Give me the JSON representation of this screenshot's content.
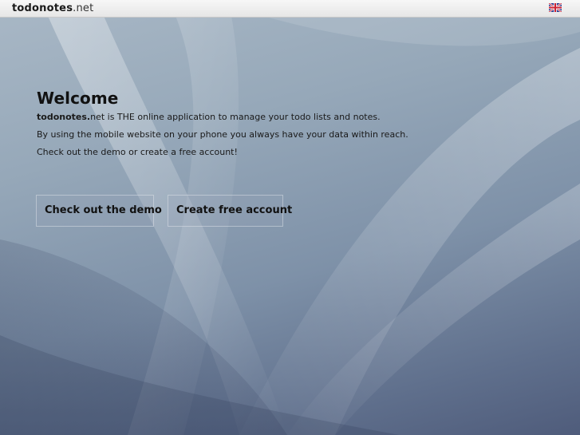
{
  "header": {
    "brand_name": "todonotes",
    "brand_tld": ".net",
    "language_icon": "uk-flag-icon"
  },
  "welcome": {
    "title": "Welcome",
    "intro_brand": "todonotes.",
    "intro_rest": "net is THE online application to manage your todo lists and notes.",
    "line2": "By using the mobile website on your phone you always have your data within reach.",
    "line3": "Check out the demo or create a free account!"
  },
  "actions": {
    "demo_label": "Check out the demo",
    "create_label": "Create free account"
  },
  "colors": {
    "background_top": "#a9b8c6",
    "background_bottom": "#4f5c7b",
    "topbar": "#eeeeee"
  }
}
